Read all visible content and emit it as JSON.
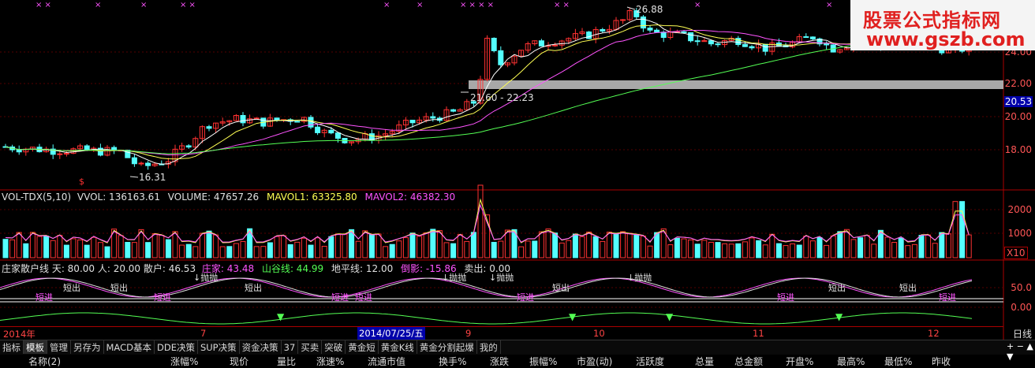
{
  "price_panel": {
    "y_labels": [
      "24.00",
      "22.00",
      "20.00",
      "18.00"
    ],
    "current_price_tag": "20.53",
    "annotations": {
      "high": "26.88",
      "low": "16.31",
      "gap": "21.60 - 22.23"
    }
  },
  "vol_panel": {
    "indicator": "VOL-TDX(5,10)",
    "vvol": "VVOL: 136163.61",
    "volume": "VOLUME: 47657.26",
    "mavol1": "MAVOL1: 63325.80",
    "mavol2": "MAVOL2: 46382.30",
    "y_labels": [
      "2000",
      "1000"
    ],
    "unit": "X10"
  },
  "zj_panel": {
    "line1": "庄家散户线 天: 80.00 人: 20.00 散户: 46.53",
    "zhuangjia": "庄家: 43.48",
    "shangu": "山谷线: 44.99",
    "dipingxian": "地平线: 12.00",
    "daoying": "倒影: -15.86",
    "maichu": "卖出: 0.00",
    "y_labels": [
      "50.0",
      "0.00"
    ],
    "markers": {
      "out": "短出",
      "in": "短进",
      "dump": "抛抛"
    }
  },
  "date_axis": {
    "labels": [
      "2014年",
      "7",
      "8",
      "9",
      "10",
      "11",
      "12"
    ],
    "highlight": "2014/07/25/五",
    "period": "日线"
  },
  "tabs": [
    "指标",
    "模板",
    "管理",
    "另存为",
    "MACD基本",
    "DDE决策",
    "SUP决策",
    "资金决策",
    "37",
    "买卖",
    "突破",
    "黄金短",
    "黄金K线",
    "黄金分割起爆",
    "我的"
  ],
  "columns": [
    "名称(2)",
    "涨幅%",
    "现价",
    "量比",
    "涨速%",
    "流通市值",
    "换手%",
    "涨跌",
    "振幅%",
    "市盈(动)",
    "活跃度",
    "总量",
    "总金额",
    "开盘%",
    "最高%",
    "最低%",
    "昨收"
  ],
  "watermark": {
    "line1": "股票公式指标网",
    "line2": "www.gszb.com"
  },
  "colors": {
    "up": "#ff3232",
    "down": "#54ffff",
    "ma5": "#ffffff",
    "ma10": "#ffff54",
    "ma20": "#ff54ff",
    "ma60": "#54ff54",
    "grid": "#aa0000"
  }
}
